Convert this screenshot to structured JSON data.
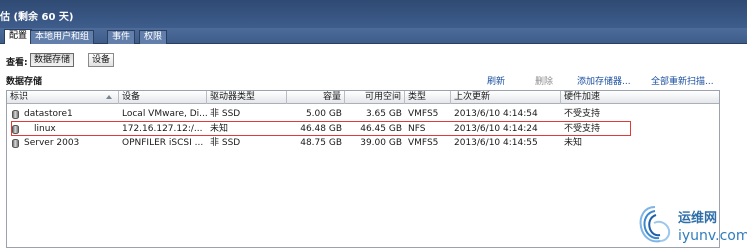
{
  "window": {
    "title": "估 (剩余 60 天)"
  },
  "tabs": [
    {
      "label": "配置",
      "active": true
    },
    {
      "label": "本地用户和组",
      "active": false
    },
    {
      "label": "事件",
      "active": false
    },
    {
      "label": "权限",
      "active": false
    }
  ],
  "view": {
    "label": "查看:",
    "options": [
      {
        "label": "数据存储",
        "active": true
      },
      {
        "label": "设备",
        "active": false
      }
    ]
  },
  "datastores": {
    "title": "数据存储",
    "actions": [
      {
        "label": "刷新",
        "enabled": true
      },
      {
        "label": "删除",
        "enabled": false
      },
      {
        "label": "添加存储器...",
        "enabled": true
      },
      {
        "label": "全部重新扫描...",
        "enabled": true
      }
    ],
    "columns": [
      "标识",
      "设备",
      "驱动器类型",
      "容量",
      "可用空间",
      "类型",
      "上次更新",
      "硬件加速"
    ],
    "rows": [
      {
        "name": "datastore1",
        "device": "Local VMware, Di...",
        "drive_type": "非 SSD",
        "capacity": "5.00 GB",
        "free": "3.65 GB",
        "type": "VMFS5",
        "updated": "2013/6/10 4:14:54",
        "hw_accel": "不受支持"
      },
      {
        "name": "linux",
        "device": "172.16.127.12:/...",
        "drive_type": "未知",
        "capacity": "46.48 GB",
        "free": "46.45 GB",
        "type": "NFS",
        "updated": "2013/6/10 4:14:24",
        "hw_accel": "不受支持"
      },
      {
        "name": "Server 2003",
        "device": "OPNFILER iSCSI ...",
        "drive_type": "非 SSD",
        "capacity": "48.75 GB",
        "free": "39.00 GB",
        "type": "VMFS5",
        "updated": "2013/6/10 4:14:55",
        "hw_accel": "未知"
      }
    ]
  },
  "watermark": {
    "text_cn": "运维网",
    "text_en": "iyunv.com"
  }
}
